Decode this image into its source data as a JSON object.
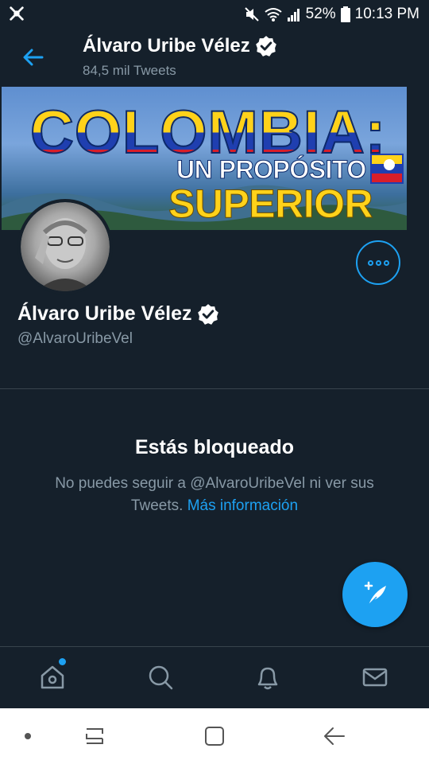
{
  "status_bar": {
    "battery": "52%",
    "time": "10:13 PM"
  },
  "header": {
    "title": "Álvaro Uribe Vélez",
    "subtitle": "84,5 mil Tweets"
  },
  "banner": {
    "line1": "COLOMBIA:",
    "line2": "UN PROPÓSITO",
    "line3": "SUPERIOR"
  },
  "profile": {
    "name": "Álvaro Uribe Vélez",
    "handle": "@AlvaroUribeVel"
  },
  "blocked": {
    "title": "Estás bloqueado",
    "text": "No puedes seguir a @AlvaroUribeVel ni ver sus Tweets.",
    "link": "Más información"
  },
  "nav": {
    "items": [
      "home-icon",
      "search-icon",
      "bell-icon",
      "mail-icon"
    ]
  },
  "colors": {
    "background": "#15202b",
    "accent": "#1da1f2",
    "secondary_text": "#8899a6"
  }
}
